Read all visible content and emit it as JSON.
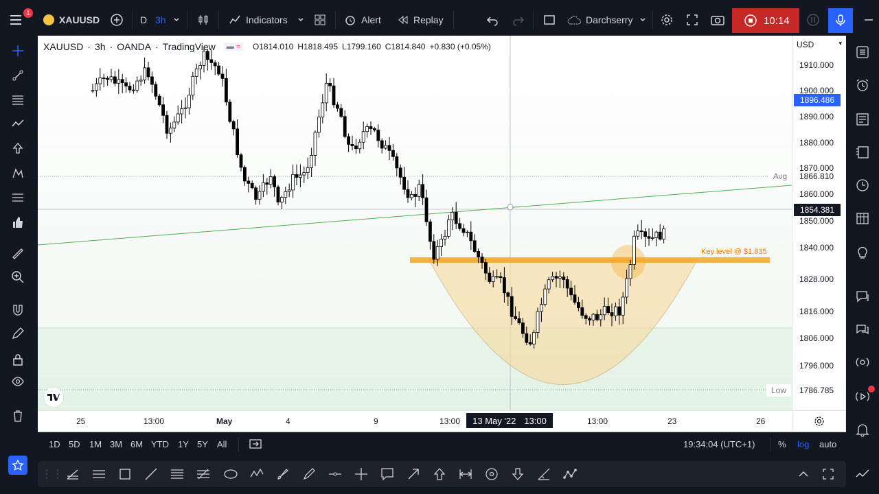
{
  "toolbar": {
    "notification_count": "1",
    "symbol": "XAUUSD",
    "interval_d": "D",
    "interval_active": "3h",
    "indicators_label": "Indicators",
    "alert_label": "Alert",
    "replay_label": "Replay",
    "layout_name": "Darchserry",
    "record_time": "10:14"
  },
  "legend": {
    "symbol": "XAUUSD",
    "interval": "3h",
    "exchange": "OANDA",
    "source": "TradingView",
    "open": "O1814.010",
    "high": "H1818.495",
    "low": "L1799.160",
    "close": "C1814.840",
    "change": "+0.830 (+0.05%)"
  },
  "price_scale": {
    "currency": "USD",
    "labels": [
      "1910.000",
      "1900.000",
      "1890.000",
      "1880.000",
      "1870.000",
      "1860.000",
      "1850.000",
      "1840.000",
      "1828.000",
      "1816.000",
      "1806.000",
      "1796.000"
    ],
    "crosshair_price": "1896.486",
    "current_price": "1854.381",
    "avg_label": "Avg",
    "avg_value": "1866.810",
    "low_label": "Low",
    "low_value": "1786.785"
  },
  "annotation": {
    "key_level": "Key level @ $1,835"
  },
  "time_scale": {
    "labels": [
      "25",
      "13:00",
      "May",
      "4",
      "9",
      "13:00",
      "13:00",
      "23",
      "26"
    ],
    "crosshair_date": "13 May '22",
    "crosshair_time": "13:00"
  },
  "bottom": {
    "ranges": [
      "1D",
      "5D",
      "1M",
      "3M",
      "6M",
      "YTD",
      "1Y",
      "5Y",
      "All"
    ],
    "clock": "19:34:04 (UTC+1)",
    "percent": "%",
    "log": "log",
    "auto": "auto"
  },
  "colors": {
    "bg_dark": "#131722",
    "accent_blue": "#2962ff",
    "record_red": "#c62828",
    "bull_candle": "#ffffff",
    "bear_candle": "#000000",
    "key_level": "#f5a623",
    "cup_fill": "#f6dca5",
    "trendline": "#4caf50"
  }
}
